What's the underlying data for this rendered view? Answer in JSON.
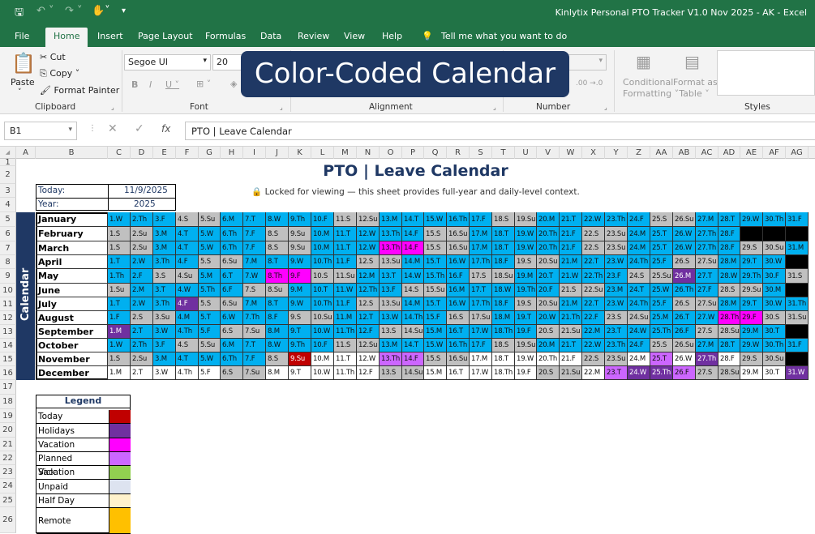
{
  "window": {
    "app_title": "Kinlytix Personal PTO Tracker V1.0 Nov 2025 - AK  -  Excel"
  },
  "ribbon_tabs": [
    "File",
    "Home",
    "Insert",
    "Page Layout",
    "Formulas",
    "Data",
    "Review",
    "View",
    "Help"
  ],
  "tell_me": "Tell me what you want to do",
  "clipboard": {
    "paste": "Paste",
    "cut": "Cut",
    "copy": "Copy",
    "format_painter": "Format Painter",
    "label": "Clipboard"
  },
  "font": {
    "family": "Segoe UI",
    "size": "20",
    "label": "Font"
  },
  "alignment": {
    "label": "Alignment"
  },
  "number": {
    "label": "Number"
  },
  "styles": {
    "conditional": "Conditional",
    "formatting": "Formatting",
    "format_as": "Format as",
    "table": "Table",
    "label": "Styles"
  },
  "banner": "Color-Coded Calendar",
  "formula_bar": {
    "name_box": "B1",
    "fx": "fx",
    "content": "PTO | Leave Calendar"
  },
  "columns": [
    "A",
    "B",
    "C",
    "D",
    "E",
    "F",
    "G",
    "H",
    "I",
    "J",
    "K",
    "L",
    "M",
    "N",
    "O",
    "P",
    "Q",
    "R",
    "S",
    "T",
    "U",
    "V",
    "W",
    "X",
    "Y",
    "Z",
    "AA",
    "AB",
    "AC",
    "AD",
    "AE",
    "AF",
    "AG"
  ],
  "rows": [
    "1",
    "2",
    "3",
    "4",
    "5",
    "6",
    "7",
    "8",
    "9",
    "10",
    "11",
    "12",
    "13",
    "14",
    "15",
    "16",
    "17",
    "18",
    "19",
    "20",
    "21",
    "22",
    "23",
    "24",
    "25",
    "26"
  ],
  "sheet": {
    "side_label": "Calendar",
    "title": "PTO | Leave Calendar",
    "lock_note": "🔒 Locked for viewing — this sheet provides full-year and daily-level context.",
    "today_label": "Today:",
    "today_value": "11/9/2025",
    "year_label": "Year:",
    "year_value": "2025"
  },
  "calendar": {
    "months": [
      "January",
      "February",
      "March",
      "April",
      "May",
      "June",
      "July",
      "August",
      "September",
      "October",
      "November",
      "December"
    ],
    "start_days": [
      3,
      6,
      6,
      2,
      4,
      0,
      2,
      5,
      1,
      3,
      6,
      1
    ],
    "day_counts": [
      31,
      28,
      31,
      30,
      31,
      30,
      31,
      31,
      30,
      31,
      30,
      31
    ],
    "weekday_abbrev": [
      "Su",
      "M",
      "T",
      "W",
      "Th",
      "F",
      "S"
    ],
    "special_days": [
      {
        "month": 4,
        "day": 8,
        "status": "vacation"
      },
      {
        "month": 4,
        "day": 9,
        "status": "vacation"
      },
      {
        "month": 4,
        "day": 26,
        "status": "holiday"
      },
      {
        "month": 2,
        "day": 13,
        "status": "vacation"
      },
      {
        "month": 2,
        "day": 14,
        "status": "vacation"
      },
      {
        "month": 6,
        "day": 4,
        "status": "holiday"
      },
      {
        "month": 7,
        "day": 28,
        "status": "vacation"
      },
      {
        "month": 7,
        "day": 29,
        "status": "vacation"
      },
      {
        "month": 8,
        "day": 1,
        "status": "holiday"
      },
      {
        "month": 10,
        "day": 9,
        "status": "today"
      },
      {
        "month": 10,
        "day": 13,
        "status": "planned"
      },
      {
        "month": 10,
        "day": 14,
        "status": "planned"
      },
      {
        "month": 10,
        "day": 25,
        "status": "planned"
      },
      {
        "month": 10,
        "day": 27,
        "status": "holiday"
      },
      {
        "month": 11,
        "day": 23,
        "status": "planned"
      },
      {
        "month": 11,
        "day": 24,
        "status": "holiday"
      },
      {
        "month": 11,
        "day": 25,
        "status": "holiday"
      },
      {
        "month": 11,
        "day": 26,
        "status": "planned"
      },
      {
        "month": 11,
        "day": 31,
        "status": "holiday"
      }
    ]
  },
  "legend": {
    "title": "Legend",
    "items": [
      {
        "label": "Today",
        "color": "#c00000"
      },
      {
        "label": "Holidays",
        "color": "#7030a0"
      },
      {
        "label": "Vacation",
        "color": "#ff00ff"
      },
      {
        "label": "Planned Vacation",
        "color": "#cc66ff"
      },
      {
        "label": "Sick",
        "color": "#92d050"
      },
      {
        "label": "Unpaid",
        "color": "#dde3f0"
      },
      {
        "label": "Half Day",
        "color": "#fff2cc"
      },
      {
        "label": "Remote",
        "color": "#ffc000"
      }
    ]
  },
  "colors": {
    "excel_green": "#217346",
    "navy": "#1f3864",
    "weekday": "#00b0f0",
    "weekend": "#c0c0c0",
    "future": "#ffffff",
    "padding": "#000000"
  }
}
